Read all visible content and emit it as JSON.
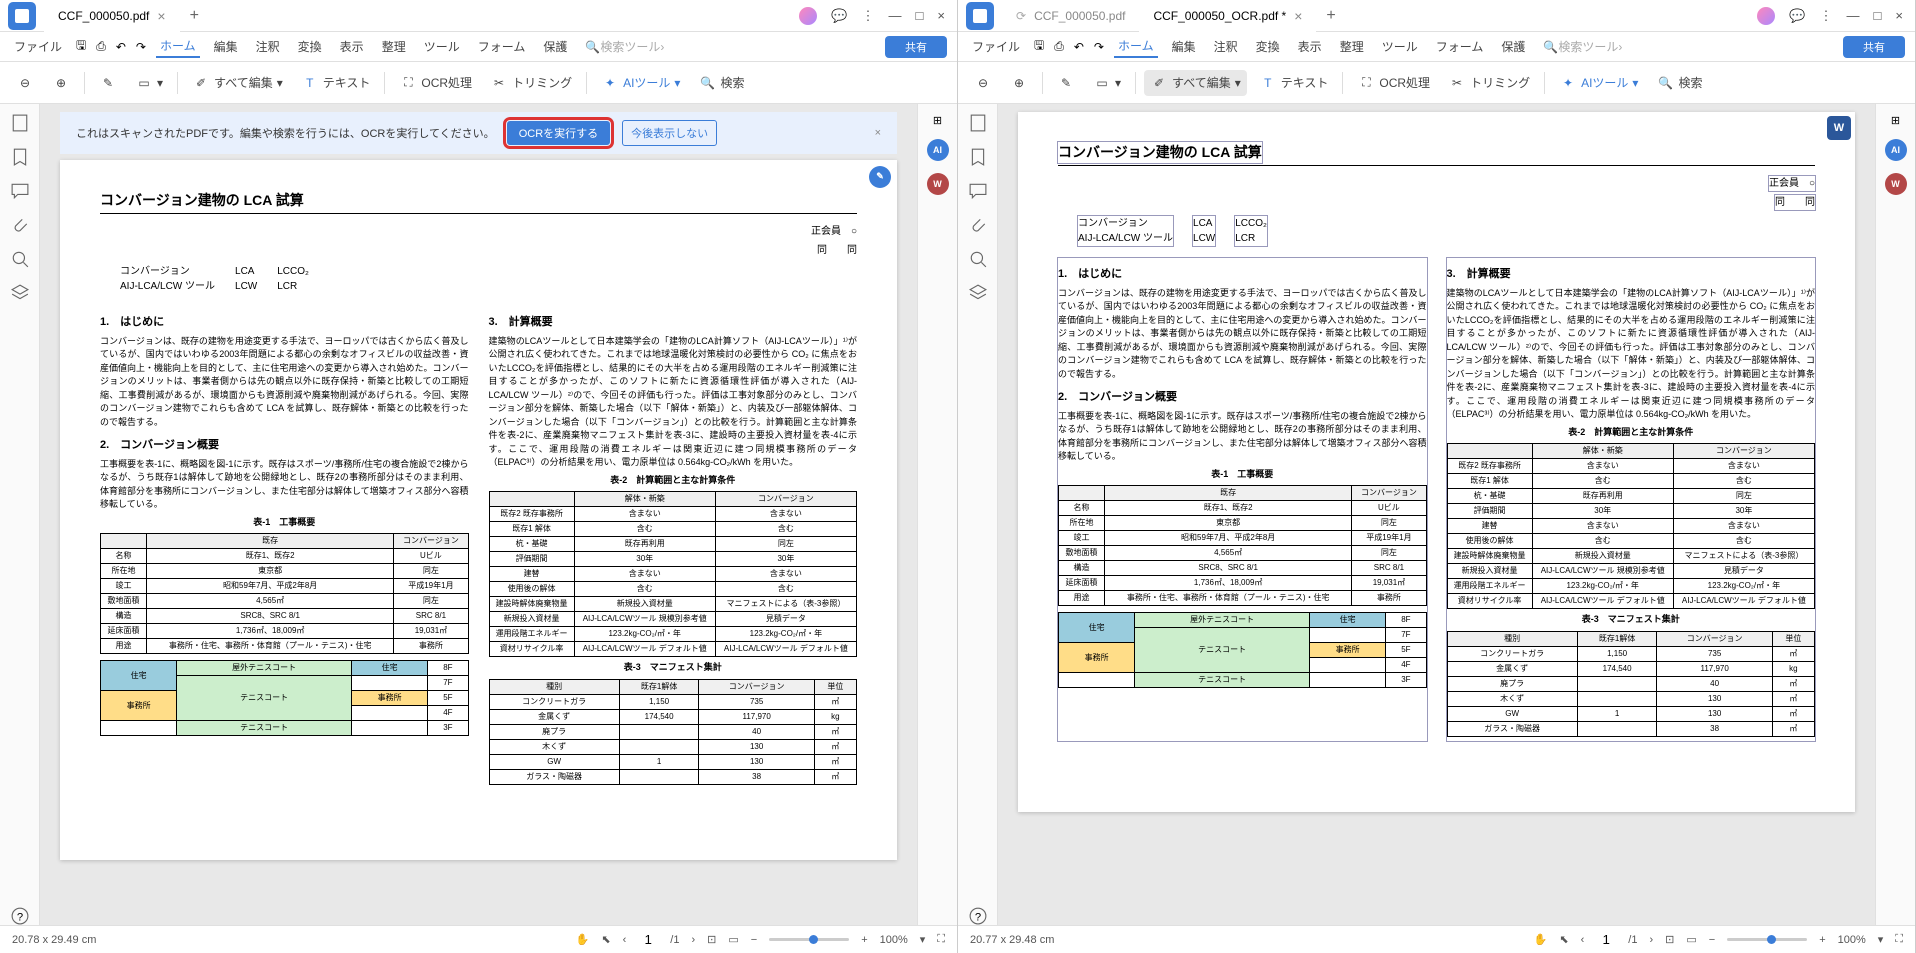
{
  "left": {
    "tab_title": "CCF_000050.pdf",
    "menus": {
      "file": "ファイル",
      "home": "ホーム",
      "edit": "編集",
      "annotate": "注釈",
      "convert": "変換",
      "view": "表示",
      "organize": "整理",
      "tools": "ツール",
      "forms": "フォーム",
      "protect": "保護",
      "search": "検索ツール"
    },
    "share": "共有",
    "toolbar": {
      "edit_all": "すべて編集",
      "text": "テキスト",
      "ocr": "OCR処理",
      "trim": "トリミング",
      "ai": "AIツール",
      "search": "検索"
    },
    "banner": {
      "msg": "これはスキャンされたPDFです。編集や検索を行うには、OCRを実行してください。",
      "run": "OCRを実行する",
      "dismiss": "今後表示しない"
    },
    "status": {
      "dim": "20.78 x 29.49 cm",
      "page": "1",
      "total": "/1",
      "zoom": "100%"
    }
  },
  "right": {
    "tab1": "CCF_000050.pdf",
    "tab2": "CCF_000050_OCR.pdf *",
    "menus": {
      "file": "ファイル",
      "home": "ホーム",
      "edit": "編集",
      "annotate": "注釈",
      "convert": "変換",
      "view": "表示",
      "organize": "整理",
      "tools": "ツール",
      "forms": "フォーム",
      "protect": "保護",
      "search": "検索ツール"
    },
    "share": "共有",
    "toolbar": {
      "edit_all": "すべて編集",
      "text": "テキスト",
      "ocr": "OCR処理",
      "trim": "トリミング",
      "ai": "AIツール",
      "search": "検索"
    },
    "status": {
      "dim": "20.77 x 29.48 cm",
      "page": "1",
      "total": "/1",
      "zoom": "100%"
    }
  },
  "doc": {
    "title": "コンバージョン建物の LCA 試算",
    "author1": "正会員　○",
    "author2": "同　　同",
    "kw": {
      "a1": "コンバージョン",
      "a2": "LCA",
      "a3": "LCCO₂",
      "b1": "AIJ-LCA/LCW ツール",
      "b2": "LCW",
      "b3": "LCR"
    },
    "s1": "1.　はじめに",
    "p1": "コンバージョンは、既存の建物を用途変更する手法で、ヨーロッパでは古くから広く普及しているが、国内ではいわゆる2003年問題による都心の余剰なオフィスビルの収益改善・資産価値向上・機能向上を目的として、主に住宅用途への変更から導入され始めた。コンバージョンのメリットは、事業者側からは先の観点以外に既存保持・新築と比較しての工期短縮、工事費削減があるが、環境面からも資源削減や廃棄物削減があげられる。今回、実際のコンバージョン建物でこれらも含めて LCA を試算し、既存解体・新築との比較を行ったので報告する。",
    "s2": "2.　コンバージョン概要",
    "p2": "工事概要を表-1に、概略図を図-1に示す。既存はスポーツ/事務所/住宅の複合施設で2棟からなるが、うち既存1は解体して跡地を公開緑地とし、既存2の事務所部分はそのまま利用、体育館部分を事務所にコンバージョンし、また住宅部分は解体して増築オフィス部分へ容積移転している。",
    "s3": "3.　計算概要",
    "p3": "建築物のLCAツールとして日本建築学会の「建物のLCA計算ソフト（AIJ-LCAツール）」¹⁾が公開され広く使われてきた。これまでは地球温暖化対策検討の必要性から CO₂ に焦点をおいたLCCO₂を評価指標とし、結果的にその大半を占める運用段階のエネルギー削減策に注目することが多かったが、このソフトに新たに資源循環性評価が導入された（AIJ-LCA/LCW ツール）²⁾ので、今回その評価も行った。評価は工事対象部分のみとし、コンバージョン部分を解体、新築した場合（以下「解体・新築」）と、内装及び一部躯体解体、コンバージョンした場合（以下「コンバージョン」）との比較を行う。計算範囲と主な計算条件を表-2に、産業廃棄物マニフェスト集計を表-3に、建設時の主要投入資材量を表-4に示す。ここで、運用段階の消費エネルギーは関東近辺に建つ同規模事務所のデータ（ELPAC³⁾）の分析結果を用い、電力原単位は 0.564kg-CO₂/kWh を用いた。",
    "t1_cap": "表-1　工事概要",
    "t1": {
      "h": [
        "",
        "既存",
        "コンバージョン"
      ],
      "r": [
        [
          "名称",
          "既存1、既存2",
          "Uビル"
        ],
        [
          "所在地",
          "東京都",
          "同左"
        ],
        [
          "竣工",
          "昭和59年7月、平成2年8月",
          "平成19年1月"
        ],
        [
          "敷地面積",
          "4,565㎡",
          "同左"
        ],
        [
          "構造",
          "SRC8、SRC 8/1",
          "SRC 8/1"
        ],
        [
          "延床面積",
          "1,736㎡、18,009㎡",
          "19,031㎡"
        ],
        [
          "用途",
          "事務所・住宅、事務所・体育館（プール・テニス)・住宅",
          "事務所"
        ]
      ]
    },
    "t2_cap": "表-2　計算範囲と主な計算条件",
    "t2": {
      "h": [
        "",
        "解体・新築",
        "コンバージョン"
      ],
      "r": [
        [
          "既存2 既存事務所",
          "含まない",
          "含まない"
        ],
        [
          "既存1 解体",
          "含む",
          "含む"
        ],
        [
          "杭・基礎",
          "既存再利用",
          "同左"
        ],
        [
          "評価期間",
          "30年",
          "30年"
        ],
        [
          "建替",
          "含まない",
          "含まない"
        ],
        [
          "使用後の解体",
          "含む",
          "含む"
        ],
        [
          "建設時解体廃棄物量",
          "新規投入資材量",
          "マニフェストによる（表-3参照）"
        ],
        [
          "新規投入資材量",
          "AIJ-LCA/LCWツール 規模別参考値",
          "見積データ"
        ],
        [
          "運用段階エネルギー",
          "123.2kg-CO₂/㎡・年",
          "123.2kg-CO₂/㎡・年"
        ],
        [
          "資材リサイクル率",
          "AIJ-LCA/LCWツール デフォルト値",
          "AIJ-LCA/LCWツール デフォルト値"
        ]
      ]
    },
    "t3_cap": "表-3　マニフェスト集計",
    "t3": {
      "h": [
        "種別",
        "既存1解体",
        "コンバージョン",
        "単位"
      ],
      "r": [
        [
          "コンクリートガラ",
          "1,150",
          "735",
          "㎥"
        ],
        [
          "金属くず",
          "174,540",
          "117,970",
          "kg"
        ],
        [
          "廃プラ",
          "",
          "40",
          "㎥"
        ],
        [
          "木くず",
          "",
          "130",
          "㎥"
        ],
        [
          "GW",
          "1",
          "130",
          "㎥"
        ],
        [
          "ガラス・陶磁器",
          "",
          "38",
          "㎥"
        ]
      ]
    },
    "fig_labels": {
      "housing": "住宅",
      "office": "事務所",
      "tennis_out": "屋外テニスコート",
      "tennis": "テニスコート",
      "f8": "8F",
      "f7": "7F",
      "f5": "5F",
      "f4": "4F",
      "f3": "3F"
    }
  }
}
